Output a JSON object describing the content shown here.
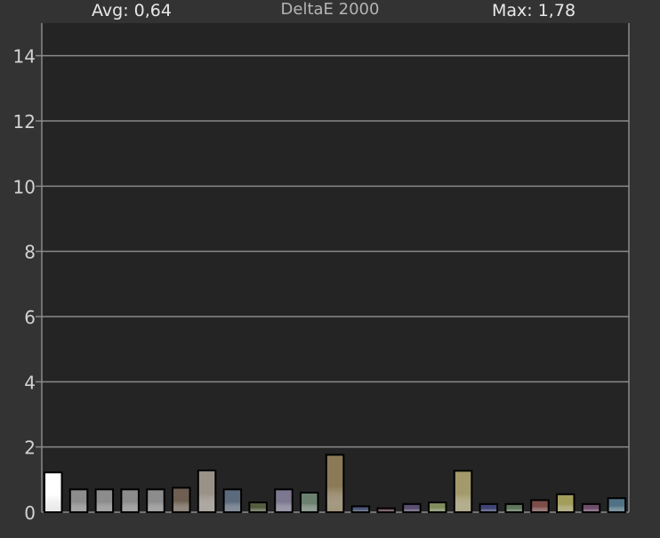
{
  "header": {
    "avg_label": "Avg: 0,64",
    "title": "DeltaE 2000",
    "max_label": "Max: 1,78"
  },
  "colors": {
    "background": "#333333",
    "plot_background": "#242424",
    "gridline": "#8a8a8a",
    "tick_label": "#d2d2d2"
  },
  "chart_data": {
    "type": "bar",
    "title": "DeltaE 2000",
    "xlabel": "",
    "ylabel": "",
    "ylim": [
      0,
      15
    ],
    "yticks": [
      0,
      2,
      4,
      6,
      8,
      10,
      12,
      14
    ],
    "grid": true,
    "legend": "none",
    "bars": [
      {
        "value": 1.22,
        "color": "#ffffff"
      },
      {
        "value": 0.7,
        "color": "#8c8c8c"
      },
      {
        "value": 0.7,
        "color": "#8c8c8c"
      },
      {
        "value": 0.7,
        "color": "#8c8c8c"
      },
      {
        "value": 0.7,
        "color": "#8c8c8c"
      },
      {
        "value": 0.75,
        "color": "#6e5f52"
      },
      {
        "value": 1.28,
        "color": "#9a9188"
      },
      {
        "value": 0.7,
        "color": "#5b6a7d"
      },
      {
        "value": 0.3,
        "color": "#555d3f"
      },
      {
        "value": 0.7,
        "color": "#7b7890"
      },
      {
        "value": 0.6,
        "color": "#6c8070"
      },
      {
        "value": 1.76,
        "color": "#8b7a56"
      },
      {
        "value": 0.18,
        "color": "#4c5677"
      },
      {
        "value": 0.12,
        "color": "#7a5a63"
      },
      {
        "value": 0.25,
        "color": "#5b4e70"
      },
      {
        "value": 0.3,
        "color": "#7f8d5c"
      },
      {
        "value": 1.27,
        "color": "#a29a6a"
      },
      {
        "value": 0.25,
        "color": "#3f4576"
      },
      {
        "value": 0.25,
        "color": "#5e7659"
      },
      {
        "value": 0.37,
        "color": "#7d4d4a"
      },
      {
        "value": 0.55,
        "color": "#a39d5c"
      },
      {
        "value": 0.25,
        "color": "#6f4e6b"
      },
      {
        "value": 0.43,
        "color": "#4f7285"
      }
    ]
  }
}
